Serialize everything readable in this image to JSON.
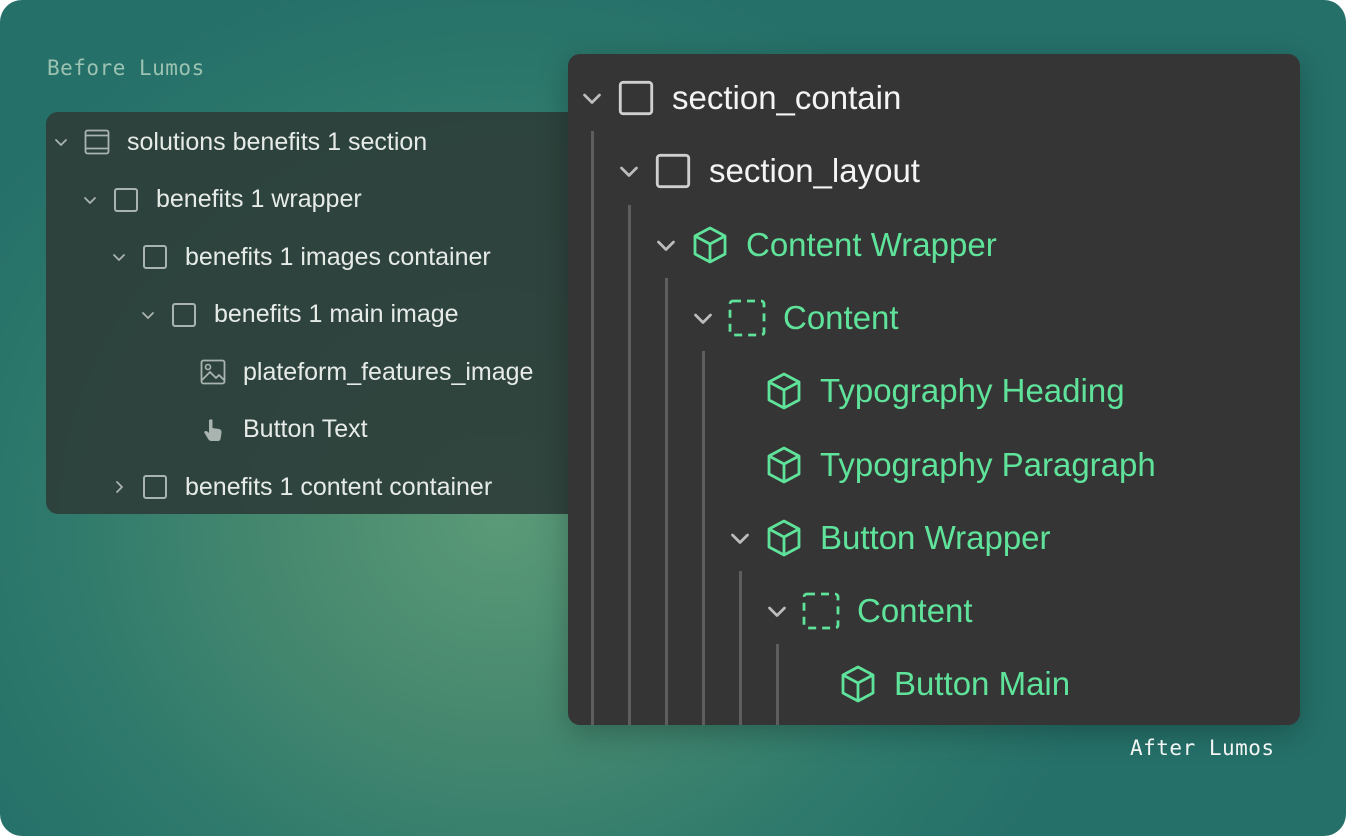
{
  "captions": {
    "before": "Before Lumos",
    "after": "After Lumos"
  },
  "before_tree": [
    {
      "label": "solutions benefits 1 section",
      "depth": 0,
      "chevron": "down",
      "icon": "section-icon"
    },
    {
      "label": "benefits 1 wrapper",
      "depth": 1,
      "chevron": "down",
      "icon": "div-box-icon"
    },
    {
      "label": "benefits 1 images container",
      "depth": 2,
      "chevron": "down",
      "icon": "div-box-icon"
    },
    {
      "label": "benefits 1 main image",
      "depth": 3,
      "chevron": "down",
      "icon": "div-box-icon"
    },
    {
      "label": "plateform_features_image",
      "depth": 4,
      "chevron": "none",
      "icon": "image-icon"
    },
    {
      "label": "Button Text",
      "depth": 4,
      "chevron": "none",
      "icon": "pointer-hand-icon"
    },
    {
      "label": "benefits 1 content container",
      "depth": 2,
      "chevron": "right",
      "icon": "div-box-icon"
    }
  ],
  "after_tree": [
    {
      "label": "section_contain",
      "depth": 0,
      "chevron": "down",
      "icon": "div-box-icon",
      "color": "white"
    },
    {
      "label": "section_layout",
      "depth": 1,
      "chevron": "down",
      "icon": "div-box-icon",
      "color": "white"
    },
    {
      "label": "Content Wrapper",
      "depth": 2,
      "chevron": "down",
      "icon": "component-icon",
      "color": "green"
    },
    {
      "label": "Content",
      "depth": 3,
      "chevron": "down",
      "icon": "slot-icon",
      "color": "green"
    },
    {
      "label": "Typography Heading",
      "depth": 4,
      "chevron": "none",
      "icon": "component-icon",
      "color": "green"
    },
    {
      "label": "Typography Paragraph",
      "depth": 4,
      "chevron": "none",
      "icon": "component-icon",
      "color": "green"
    },
    {
      "label": "Button Wrapper",
      "depth": 4,
      "chevron": "down",
      "icon": "component-icon",
      "color": "green"
    },
    {
      "label": "Content",
      "depth": 5,
      "chevron": "down",
      "icon": "slot-icon",
      "color": "green"
    },
    {
      "label": "Button Main",
      "depth": 6,
      "chevron": "none",
      "icon": "component-icon",
      "color": "green"
    }
  ],
  "colors": {
    "accent_green": "#5fe39a",
    "panel_dark": "#353535"
  }
}
